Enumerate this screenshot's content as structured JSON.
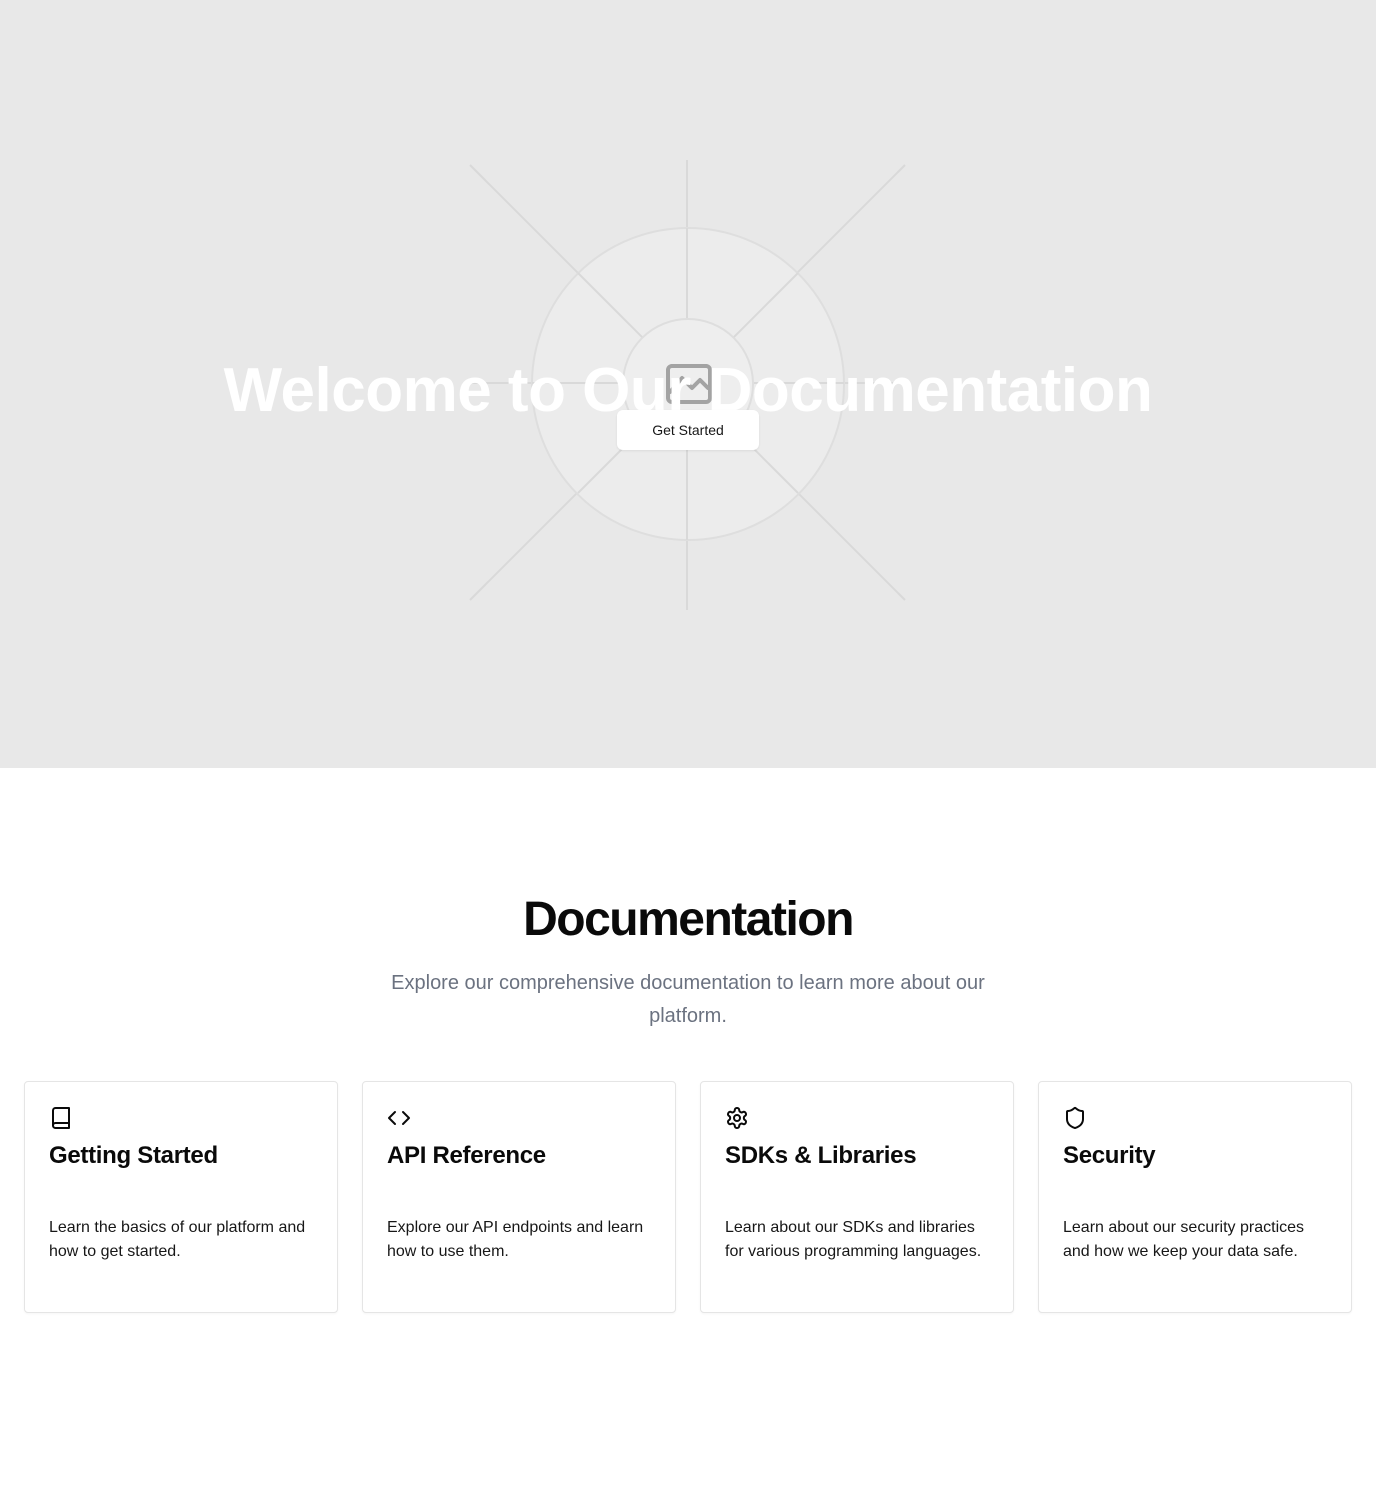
{
  "hero": {
    "title": "Welcome to Our Documentation",
    "button_label": "Get Started",
    "background_color": "#e8e8e8",
    "image_icon": "image-placeholder-icon"
  },
  "docs": {
    "title": "Documentation",
    "subtitle": "Explore our comprehensive documentation to learn more about our platform.",
    "cards": [
      {
        "icon": "book-icon",
        "title": "Getting Started",
        "description": "Learn the basics of our platform and how to get started."
      },
      {
        "icon": "code-icon",
        "title": "API Reference",
        "description": "Explore our API endpoints and learn how to use them."
      },
      {
        "icon": "gear-icon",
        "title": "SDKs & Libraries",
        "description": "Learn about our SDKs and libraries for various programming languages."
      },
      {
        "icon": "shield-icon",
        "title": "Security",
        "description": "Learn about our security practices and how we keep your data safe."
      }
    ]
  }
}
